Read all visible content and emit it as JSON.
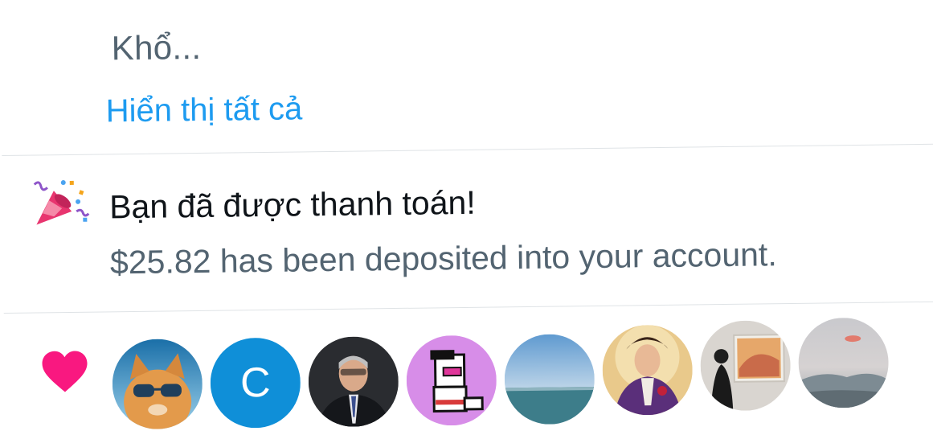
{
  "previous_notification": {
    "snippet": "Khổ...",
    "show_all_label": "Hiển thị tất cả"
  },
  "payout_notification": {
    "icon": "party-popper-icon",
    "title": "Bạn đã được thanh toán!",
    "body": "$25.82 has been deposited into your account."
  },
  "likes_notification": {
    "icon": "heart-icon",
    "avatars": [
      {
        "kind": "cat-with-sunglasses-photo"
      },
      {
        "kind": "letter",
        "letter": "C"
      },
      {
        "kind": "man-in-suit-photo"
      },
      {
        "kind": "pixel-art-character"
      },
      {
        "kind": "sea-and-sky-photo"
      },
      {
        "kind": "game-character-art"
      },
      {
        "kind": "person-viewing-painting-photo"
      },
      {
        "kind": "foggy-coast-sunset-photo"
      }
    ]
  },
  "colors": {
    "link": "#1d9bf0",
    "primary_text": "#0f1419",
    "secondary_text": "#536471",
    "heart": "#f91880",
    "divider": "#dfe3e6",
    "letter_avatar_bg": "#0f8fd8"
  }
}
